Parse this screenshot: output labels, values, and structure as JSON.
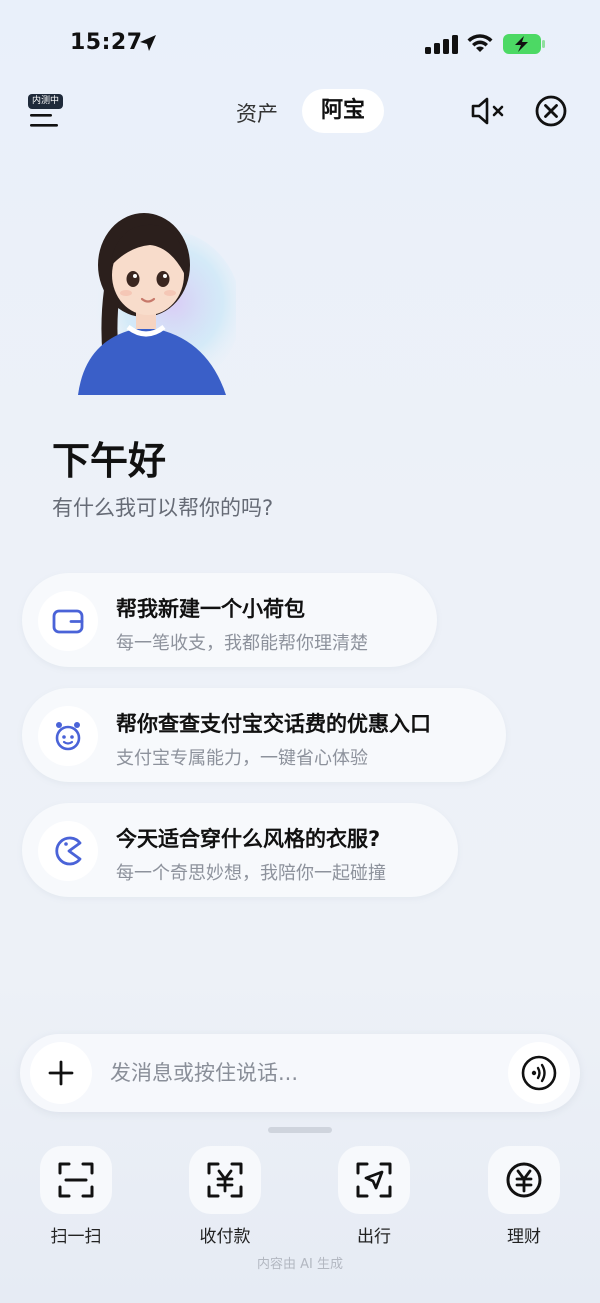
{
  "status_bar": {
    "time": "15:27"
  },
  "topbar": {
    "beta_badge": "内测中",
    "tabs": [
      {
        "label": "资产"
      },
      {
        "label": "阿宝"
      }
    ]
  },
  "hero": {
    "greeting": "下午好",
    "subtitle": "有什么我可以帮你的吗?"
  },
  "suggestions": [
    {
      "title": "帮我新建一个小荷包",
      "subtitle": "每一笔收支，我都能帮你理清楚",
      "icon": "wallet-icon"
    },
    {
      "title": "帮你查查支付宝交话费的优惠入口",
      "subtitle": "支付宝专属能力，一键省心体验",
      "icon": "robot-icon"
    },
    {
      "title": "今天适合穿什么风格的衣服?",
      "subtitle": "每一个奇思妙想，我陪你一起碰撞",
      "icon": "pacman-icon"
    }
  ],
  "composer": {
    "placeholder": "发消息或按住说话..."
  },
  "dock": [
    {
      "label": "扫一扫",
      "icon": "scan-icon"
    },
    {
      "label": "收付款",
      "icon": "payment-icon"
    },
    {
      "label": "出行",
      "icon": "travel-icon"
    },
    {
      "label": "理财",
      "icon": "finance-icon"
    }
  ],
  "footer_note": "内容由 AI 生成",
  "colors": {
    "accent_icon": "#4a63d8",
    "battery": "#4cd964"
  }
}
